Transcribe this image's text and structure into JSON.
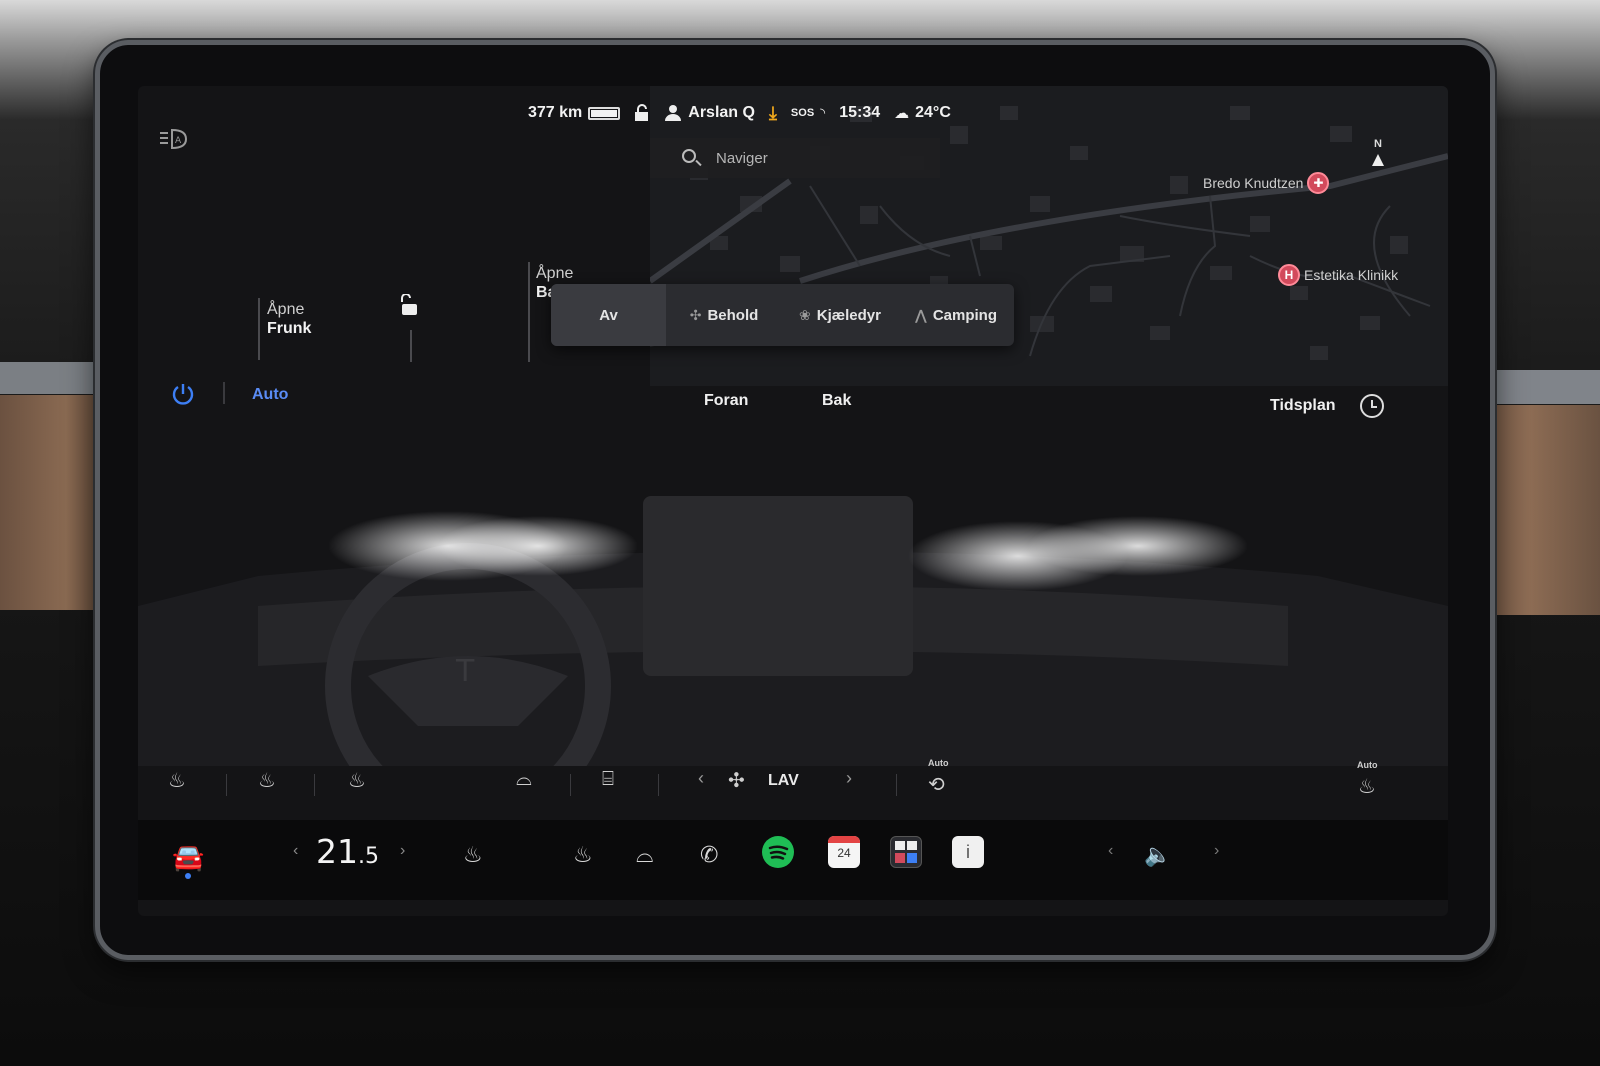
{
  "status_bar": {
    "range": "377 km",
    "driver": "Arslan Q",
    "sos": "SOS",
    "time": "15:34",
    "temperature": "24°C"
  },
  "map": {
    "search_placeholder": "Naviger",
    "pois": [
      {
        "name": "Bredo Knudtzen",
        "icon": "hospital-pin-icon"
      },
      {
        "name": "Estetika Klinikk",
        "icon": "hospital-pin-icon",
        "letter": "H"
      }
    ],
    "compass": {
      "n": "N"
    }
  },
  "quick": {
    "frunk_line1": "Åpne",
    "frunk_line2": "Frunk",
    "trunk_line1": "Åpne",
    "trunk_line2": "Ba"
  },
  "cabin_mode": {
    "options": [
      {
        "label": "Av",
        "icon": ""
      },
      {
        "label": "Behold",
        "icon": "fan-icon"
      },
      {
        "label": "Kjæledyr",
        "icon": "paw-icon"
      },
      {
        "label": "Camping",
        "icon": "tent-icon"
      }
    ],
    "selected": "Av"
  },
  "climate": {
    "auto_label": "Auto",
    "tabs": [
      "Foran",
      "Bak"
    ],
    "schedule_label": "Tidsplan",
    "fan_speed": "LAV",
    "recirc_auto": "Auto",
    "seat_auto": "Auto"
  },
  "dock": {
    "temperature": "21",
    "temperature_decimal": ".5",
    "calendar_day": "24"
  },
  "colors": {
    "accent": "#3d7ff5",
    "spotify": "#1fbd55",
    "phone": "#20c35a",
    "download": "#f0a81c",
    "poi": "#d24a5c"
  }
}
